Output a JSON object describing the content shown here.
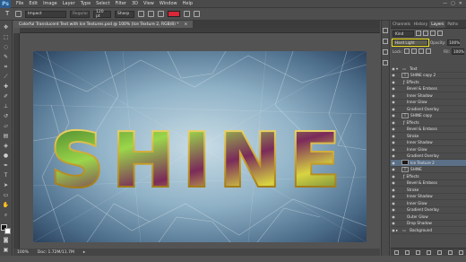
{
  "menu": {
    "app": "Ps",
    "items": [
      "File",
      "Edit",
      "Image",
      "Layer",
      "Type",
      "Select",
      "Filter",
      "3D",
      "View",
      "Window",
      "Help"
    ]
  },
  "options": {
    "font": "Impact",
    "style": "Regular",
    "size": "120 pt",
    "aa": "Sharp",
    "swatch": "#d8283a"
  },
  "document": {
    "tab_title": "Colorful Translucent Text with Ice Textures.psd @ 100% (Ice Texture 2, RGB/8) *",
    "canvas_text": "SHINE",
    "zoom": "100%",
    "doc_info": "Doc: 1.72M/11.7M"
  },
  "panel": {
    "tabs": [
      "Channels",
      "History",
      "Layers",
      "Paths"
    ],
    "active_tab": "Layers",
    "kind": "Kind",
    "blend_mode": "Hard Light",
    "opacity_label": "Opacity:",
    "opacity": "100%",
    "lock_label": "Lock:",
    "fill_label": "Fill:",
    "fill": "100%"
  },
  "layers": [
    {
      "name": "Text",
      "type": "group",
      "indent": 0,
      "selected": false,
      "visible": true
    },
    {
      "name": "SHINE copy 2",
      "type": "text",
      "indent": 1,
      "selected": false,
      "visible": true
    },
    {
      "name": "Effects",
      "type": "effects",
      "indent": 2,
      "selected": false,
      "visible": true
    },
    {
      "name": "Bevel & Emboss",
      "type": "fx",
      "indent": 3,
      "selected": false,
      "visible": true
    },
    {
      "name": "Inner Shadow",
      "type": "fx",
      "indent": 3,
      "selected": false,
      "visible": true
    },
    {
      "name": "Inner Glow",
      "type": "fx",
      "indent": 3,
      "selected": false,
      "visible": true
    },
    {
      "name": "Gradient Overlay",
      "type": "fx",
      "indent": 3,
      "selected": false,
      "visible": true
    },
    {
      "name": "SHINE copy",
      "type": "text",
      "indent": 1,
      "selected": false,
      "visible": true
    },
    {
      "name": "Effects",
      "type": "effects",
      "indent": 2,
      "selected": false,
      "visible": true
    },
    {
      "name": "Bevel & Emboss",
      "type": "fx",
      "indent": 3,
      "selected": false,
      "visible": true
    },
    {
      "name": "Stroke",
      "type": "fx",
      "indent": 3,
      "selected": false,
      "visible": true
    },
    {
      "name": "Inner Shadow",
      "type": "fx",
      "indent": 3,
      "selected": false,
      "visible": true
    },
    {
      "name": "Inner Glow",
      "type": "fx",
      "indent": 3,
      "selected": false,
      "visible": true
    },
    {
      "name": "Gradient Overlay",
      "type": "fx",
      "indent": 3,
      "selected": false,
      "visible": true
    },
    {
      "name": "Ice Texture 2",
      "type": "image",
      "indent": 1,
      "selected": true,
      "visible": true
    },
    {
      "name": "SHINE",
      "type": "text",
      "indent": 1,
      "selected": false,
      "visible": true
    },
    {
      "name": "Effects",
      "type": "effects",
      "indent": 2,
      "selected": false,
      "visible": true
    },
    {
      "name": "Bevel & Emboss",
      "type": "fx",
      "indent": 3,
      "selected": false,
      "visible": true
    },
    {
      "name": "Stroke",
      "type": "fx",
      "indent": 3,
      "selected": false,
      "visible": true
    },
    {
      "name": "Inner Shadow",
      "type": "fx",
      "indent": 3,
      "selected": false,
      "visible": true
    },
    {
      "name": "Inner Glow",
      "type": "fx",
      "indent": 3,
      "selected": false,
      "visible": true
    },
    {
      "name": "Gradient Overlay",
      "type": "fx",
      "indent": 3,
      "selected": false,
      "visible": true
    },
    {
      "name": "Outer Glow",
      "type": "fx",
      "indent": 3,
      "selected": false,
      "visible": true
    },
    {
      "name": "Drop Shadow",
      "type": "fx",
      "indent": 3,
      "selected": false,
      "visible": true
    },
    {
      "name": "Background",
      "type": "group",
      "indent": 0,
      "selected": false,
      "visible": true
    }
  ]
}
